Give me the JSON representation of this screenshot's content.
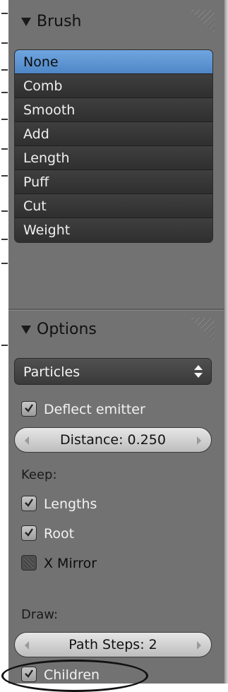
{
  "brush_panel": {
    "title": "Brush",
    "items": [
      {
        "label": "None",
        "selected": true
      },
      {
        "label": "Comb",
        "selected": false
      },
      {
        "label": "Smooth",
        "selected": false
      },
      {
        "label": "Add",
        "selected": false
      },
      {
        "label": "Length",
        "selected": false
      },
      {
        "label": "Puff",
        "selected": false
      },
      {
        "label": "Cut",
        "selected": false
      },
      {
        "label": "Weight",
        "selected": false
      }
    ]
  },
  "options_panel": {
    "title": "Options",
    "mode_dropdown": {
      "value": "Particles"
    },
    "deflect_emitter": {
      "label": "Deflect emitter",
      "checked": true
    },
    "distance_field": {
      "text": "Distance: 0.250"
    },
    "keep_label": "Keep:",
    "keep": [
      {
        "label": "Lengths",
        "checked": true
      },
      {
        "label": "Root",
        "checked": true
      },
      {
        "label": "X Mirror",
        "checked": false
      }
    ],
    "draw_label": "Draw:",
    "path_steps_field": {
      "text": "Path Steps: 2"
    },
    "children": {
      "label": "Children",
      "checked": true
    }
  },
  "colors": {
    "panel_bg": "#727272",
    "selected_item": "#5b93d3",
    "list_item": "#383838"
  }
}
